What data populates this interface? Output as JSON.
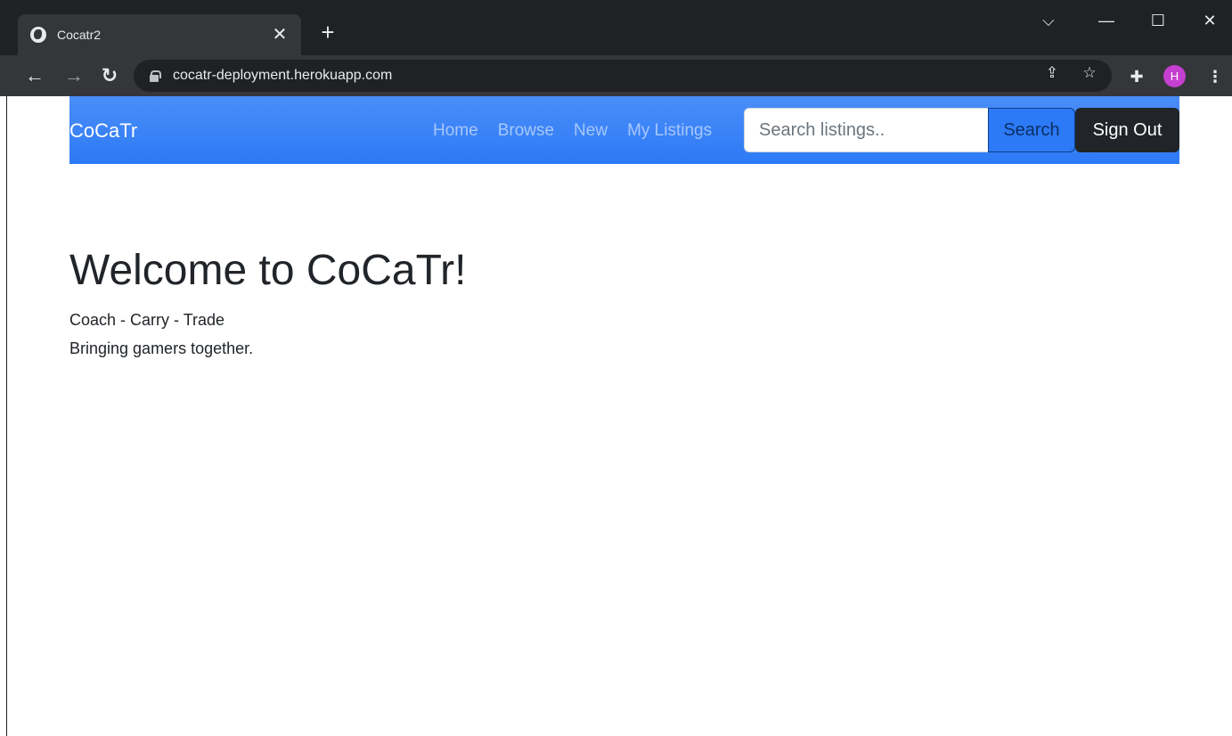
{
  "browser": {
    "tab_title": "Cocatr2",
    "tab_close": "✕",
    "new_tab": "+",
    "url": "cocatr-deployment.herokuapp.com",
    "profile_initial": "H",
    "icons": [
      "globe-icon",
      "close-icon",
      "plus-icon",
      "chevron-down-icon",
      "minimize-icon",
      "maximize-icon",
      "close-icon",
      "back-arrow-icon",
      "forward-arrow-icon",
      "reload-icon",
      "lock-icon",
      "share-icon",
      "star-icon",
      "extensions-icon",
      "avatar",
      "kebab-menu-icon"
    ]
  },
  "navbar": {
    "brand": "CoCaTr",
    "links": [
      "Home",
      "Browse",
      "New",
      "My Listings"
    ],
    "search_placeholder": "Search listings..",
    "search_button": "Search",
    "signout_button": "Sign Out",
    "background_color": "#2d7af6"
  },
  "hero": {
    "title": "Welcome to CoCaTr!",
    "line1": "Coach - Carry - Trade",
    "line2": "Bringing gamers together."
  }
}
